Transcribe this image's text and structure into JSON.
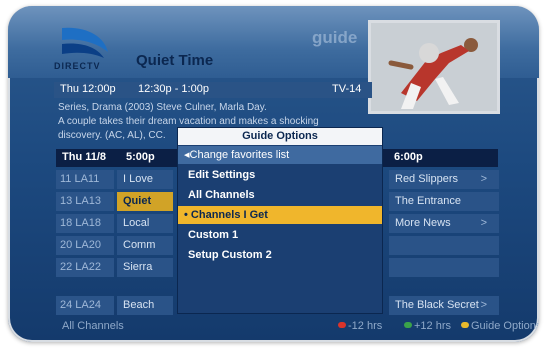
{
  "header": {
    "brand": "DIRECTV",
    "title": "Quiet Time",
    "section_label": "guide",
    "info": {
      "date": "Thu 12:00p",
      "time_range": "12:30p - 1:00p",
      "rating": "TV-14"
    },
    "description": [
      "Series, Drama (2003) Steve Culner, Marla Day.",
      "A couple takes their dream vacation and makes a shocking",
      "discovery. (AC, AL), CC."
    ]
  },
  "grid": {
    "header": {
      "date": "Thu 11/8",
      "time1": "5:00p",
      "time2": "6:00p"
    },
    "rows": [
      {
        "channel": "11 LA11",
        "program": "I Love",
        "right": "Red Slippers",
        "arrow": ">"
      },
      {
        "channel": "13 LA13",
        "program": "Quiet",
        "right": "The Entrance",
        "arrow": ""
      },
      {
        "channel": "18 LA18",
        "program": "Local",
        "right": "More News",
        "arrow": ">"
      },
      {
        "channel": "20 LA20",
        "program": "Comm",
        "right": "",
        "arrow": ""
      },
      {
        "channel": "22 LA22",
        "program": "Sierra",
        "right": "",
        "arrow": ""
      },
      {
        "channel": "24 LA24",
        "program": "Beach",
        "right": "The Black Secret",
        "arrow": ">"
      }
    ]
  },
  "footer": {
    "channel_filter": "All Channels",
    "minus": "-12 hrs",
    "plus": "+12 hrs",
    "options": "Guide Options"
  },
  "popup": {
    "title": "Guide Options",
    "change": "Change favorites list",
    "items": [
      {
        "label": "Edit Settings",
        "selected": false
      },
      {
        "label": "All Channels",
        "selected": false
      },
      {
        "label": "Channels I Get",
        "selected": true
      },
      {
        "label": "Custom 1",
        "selected": false
      },
      {
        "label": "Setup Custom 2",
        "selected": false
      }
    ]
  },
  "colors": {
    "accent": "#f0b62c",
    "highlight": "#d1a327",
    "background": "#1d4a80",
    "red_button": "#d9342b",
    "green_button": "#3aa24a",
    "yellow_button": "#e8b92c"
  },
  "icons": [
    "directv-logo-icon",
    "left-arrow-icon",
    "right-chevron-icon",
    "red-button-icon",
    "green-button-icon",
    "yellow-button-icon"
  ]
}
